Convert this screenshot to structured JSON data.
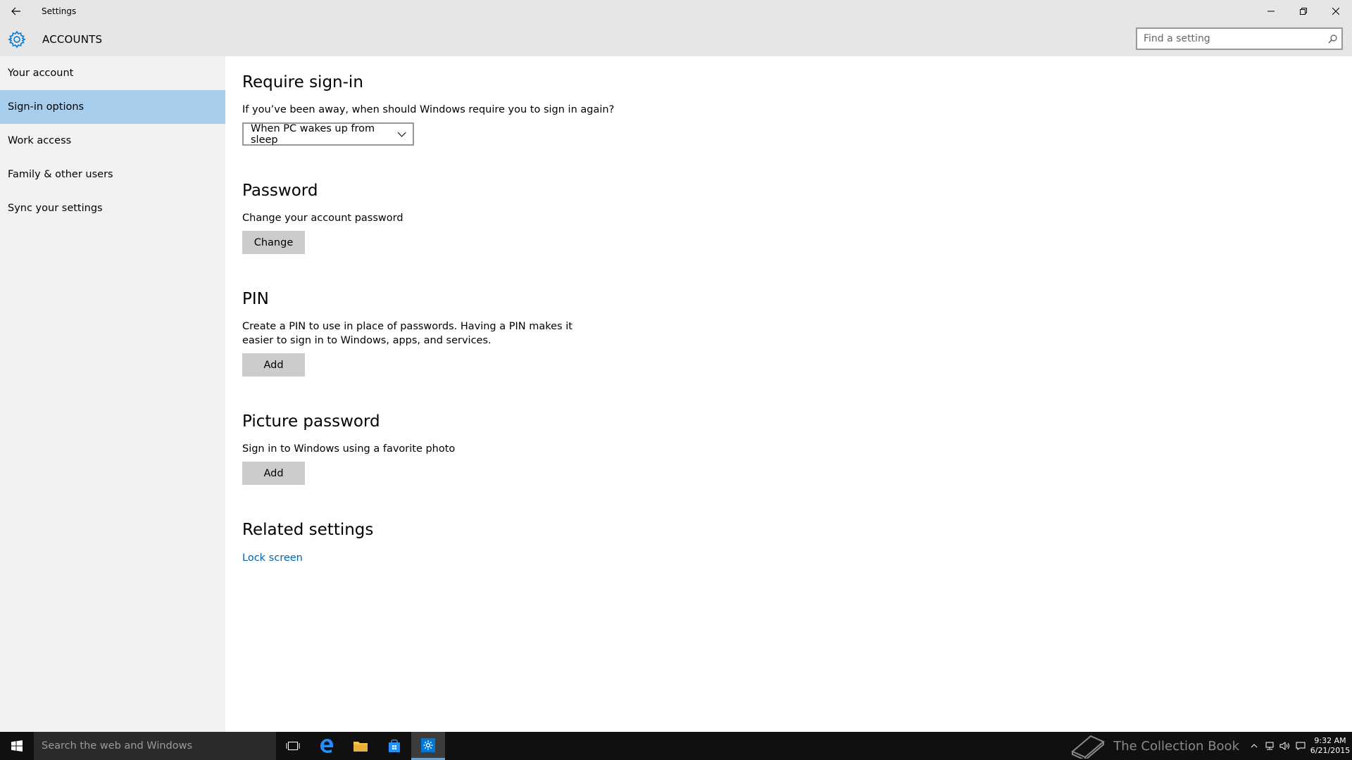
{
  "window": {
    "title": "Settings"
  },
  "header": {
    "section": "ACCOUNTS",
    "search_placeholder": "Find a setting"
  },
  "sidebar": {
    "items": [
      {
        "label": "Your account"
      },
      {
        "label": "Sign-in options",
        "selected": true
      },
      {
        "label": "Work access"
      },
      {
        "label": "Family & other users"
      },
      {
        "label": "Sync your settings"
      }
    ]
  },
  "main": {
    "require_signin": {
      "title": "Require sign-in",
      "question": "If you’ve been away, when should Windows require you to sign in again?",
      "dropdown_value": "When PC wakes up from sleep"
    },
    "password": {
      "title": "Password",
      "description": "Change your account password",
      "button": "Change"
    },
    "pin": {
      "title": "PIN",
      "description_line1": "Create a PIN to use in place of passwords. Having a PIN makes it",
      "description_line2": "easier to sign in to Windows, apps, and services.",
      "button": "Add"
    },
    "picture_password": {
      "title": "Picture password",
      "description": "Sign in to Windows using a favorite photo",
      "button": "Add"
    },
    "related": {
      "title": "Related settings",
      "link": "Lock screen"
    }
  },
  "taskbar": {
    "search_placeholder": "Search the web and Windows",
    "watermark": "The Collection Book",
    "time": "9:32 AM",
    "date": "6/21/2015"
  },
  "colors": {
    "accent": "#0078d7",
    "selected_nav": "#a6cdec",
    "link": "#0063b1",
    "chrome": "#e6e6e6",
    "sidebar": "#f2f2f2",
    "taskbar": "#101010"
  },
  "icons": [
    "back-arrow-icon",
    "minimize-icon",
    "restore-icon",
    "close-icon",
    "gear-icon",
    "search-icon",
    "chevron-down-icon",
    "windows-logo-icon",
    "task-view-icon",
    "edge-icon",
    "file-explorer-icon",
    "store-icon",
    "settings-icon",
    "book-icon",
    "chevron-up-icon",
    "network-icon",
    "volume-icon",
    "notification-icon"
  ]
}
